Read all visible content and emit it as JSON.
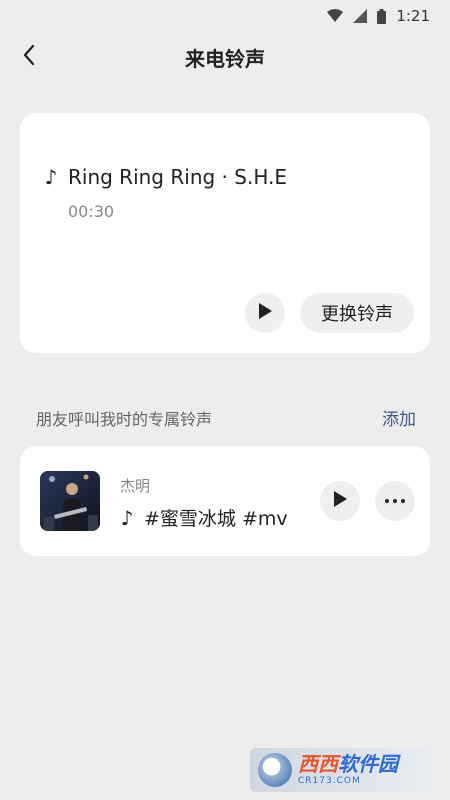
{
  "status_bar": {
    "time": "1:21",
    "icons": [
      "wifi-icon",
      "signal-icon",
      "battery-icon"
    ]
  },
  "header": {
    "title": "来电铃声",
    "back_icon": "chevron-left-icon"
  },
  "current_ringtone": {
    "icon": "music-note-icon",
    "song": "Ring Ring Ring · S.H.E",
    "duration": "00:30",
    "play_icon": "play-icon",
    "change_label": "更换铃声"
  },
  "section": {
    "title": "朋友呼叫我时的专属铃声",
    "add_label": "添加"
  },
  "contacts": [
    {
      "name": "杰明",
      "song": "#蜜雪冰城 #mv",
      "note_icon": "music-note-icon",
      "play_icon": "play-icon",
      "more_icon": "more-dots-icon"
    }
  ],
  "watermark": {
    "main_a": "西西",
    "main_b": "软件园",
    "sub": "CR173.COM"
  },
  "colors": {
    "background": "#ededed",
    "card": "#ffffff",
    "accent_link": "#3b5a8c",
    "button_bg": "#efefef"
  }
}
